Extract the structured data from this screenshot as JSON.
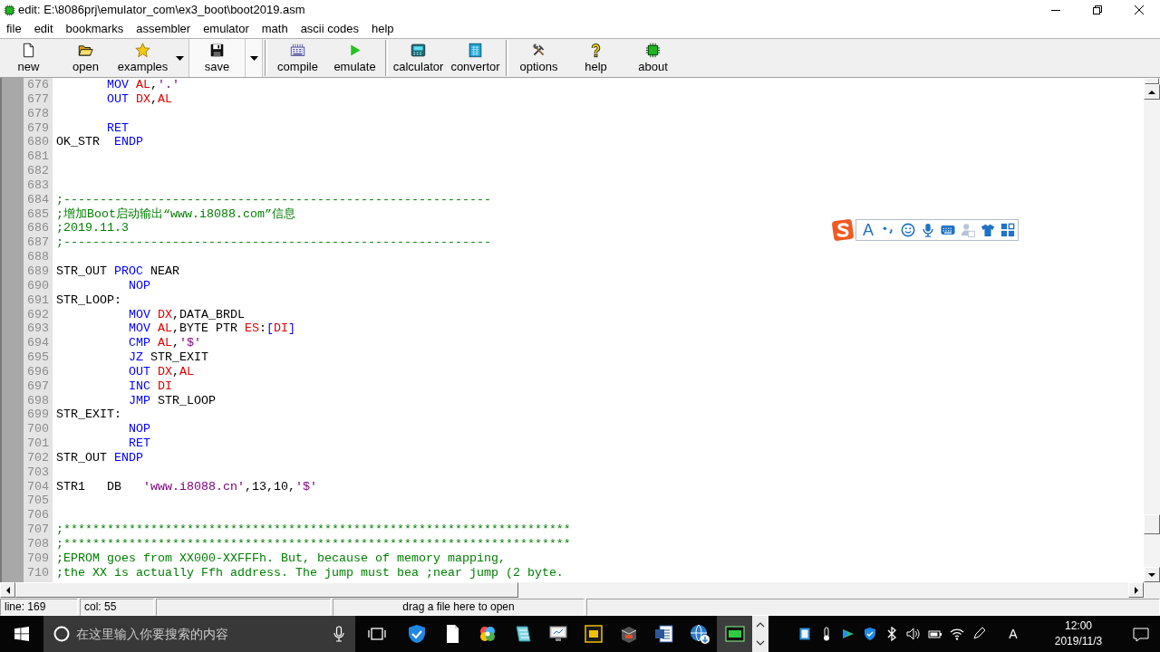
{
  "window": {
    "title": "edit: E:\\8086prj\\emulator_com\\ex3_boot\\boot2019.asm"
  },
  "menu": [
    "file",
    "edit",
    "bookmarks",
    "assembler",
    "emulator",
    "math",
    "ascii codes",
    "help"
  ],
  "toolbar": [
    {
      "buttons": [
        {
          "label": "new",
          "dropdown": false,
          "highlighted": false
        },
        {
          "label": "open",
          "dropdown": false,
          "highlighted": false
        },
        {
          "label": "examples",
          "dropdown": true,
          "highlighted": false
        },
        {
          "label": "save",
          "dropdown": true,
          "highlighted": true
        }
      ]
    },
    {
      "buttons": [
        {
          "label": "compile",
          "dropdown": false,
          "highlighted": false
        },
        {
          "label": "emulate",
          "dropdown": false,
          "highlighted": false
        }
      ]
    },
    {
      "buttons": [
        {
          "label": "calculator",
          "dropdown": false,
          "highlighted": false
        },
        {
          "label": "convertor",
          "dropdown": false,
          "highlighted": false
        }
      ]
    },
    {
      "buttons": [
        {
          "label": "options",
          "dropdown": false,
          "highlighted": false
        },
        {
          "label": "help",
          "dropdown": false,
          "highlighted": false
        },
        {
          "label": "about",
          "dropdown": false,
          "highlighted": false
        }
      ]
    }
  ],
  "editor": {
    "lines": [
      {
        "number": "676",
        "tokens": [
          {
            "kind": "keyword",
            "text": "       MOV"
          },
          {
            "kind": "register",
            "text": " AL"
          },
          {
            "kind": "plain",
            "text": ","
          },
          {
            "kind": "string",
            "text": "'.'"
          }
        ]
      },
      {
        "number": "677",
        "tokens": [
          {
            "kind": "keyword",
            "text": "       OUT"
          },
          {
            "kind": "register",
            "text": " DX"
          },
          {
            "kind": "plain",
            "text": ","
          },
          {
            "kind": "register",
            "text": "AL"
          }
        ]
      },
      {
        "number": "678"
      },
      {
        "number": "679",
        "tokens": [
          {
            "kind": "keyword",
            "text": "       RET"
          }
        ]
      },
      {
        "number": "680",
        "tokens": [
          {
            "kind": "plain",
            "text": "OK_STR"
          },
          {
            "kind": "keyword",
            "text": "  ENDP"
          }
        ]
      },
      {
        "number": "681"
      },
      {
        "number": "682"
      },
      {
        "number": "683"
      },
      {
        "number": "684",
        "tokens": [
          {
            "kind": "comment",
            "text": ";-----------------------------------------------------------"
          }
        ]
      },
      {
        "number": "685",
        "tokens": [
          {
            "kind": "comment",
            "text": ";增加Boot启动输出“www.i8088.com”信息"
          }
        ]
      },
      {
        "number": "686",
        "tokens": [
          {
            "kind": "comment",
            "text": ";2019.11.3"
          }
        ]
      },
      {
        "number": "687",
        "tokens": [
          {
            "kind": "comment",
            "text": ";-----------------------------------------------------------"
          }
        ]
      },
      {
        "number": "688"
      },
      {
        "number": "689",
        "tokens": [
          {
            "kind": "plain",
            "text": "STR_OUT"
          },
          {
            "kind": "keyword",
            "text": " PROC"
          },
          {
            "kind": "plain",
            "text": " NEAR"
          }
        ]
      },
      {
        "number": "690",
        "tokens": [
          {
            "kind": "keyword",
            "text": "          NOP"
          }
        ]
      },
      {
        "number": "691",
        "tokens": [
          {
            "kind": "plain",
            "text": "STR_LOOP:"
          }
        ]
      },
      {
        "number": "692",
        "tokens": [
          {
            "kind": "keyword",
            "text": "          MOV"
          },
          {
            "kind": "register",
            "text": " DX"
          },
          {
            "kind": "plain",
            "text": ",DATA_BRDL"
          }
        ]
      },
      {
        "number": "693",
        "tokens": [
          {
            "kind": "keyword",
            "text": "          MOV"
          },
          {
            "kind": "register",
            "text": " AL"
          },
          {
            "kind": "plain",
            "text": ",BYTE PTR "
          },
          {
            "kind": "register",
            "text": "ES"
          },
          {
            "kind": "plain",
            "text": ":"
          },
          {
            "kind": "keyword",
            "text": "["
          },
          {
            "kind": "register",
            "text": "DI"
          },
          {
            "kind": "keyword",
            "text": "]"
          }
        ]
      },
      {
        "number": "694",
        "tokens": [
          {
            "kind": "keyword",
            "text": "          CMP"
          },
          {
            "kind": "register",
            "text": " AL"
          },
          {
            "kind": "plain",
            "text": ","
          },
          {
            "kind": "string",
            "text": "'$'"
          }
        ]
      },
      {
        "number": "695",
        "tokens": [
          {
            "kind": "keyword",
            "text": "          JZ"
          },
          {
            "kind": "plain",
            "text": " STR_EXIT"
          }
        ]
      },
      {
        "number": "696",
        "tokens": [
          {
            "kind": "keyword",
            "text": "          OUT"
          },
          {
            "kind": "register",
            "text": " DX"
          },
          {
            "kind": "plain",
            "text": ","
          },
          {
            "kind": "register",
            "text": "AL"
          }
        ]
      },
      {
        "number": "697",
        "tokens": [
          {
            "kind": "keyword",
            "text": "          INC"
          },
          {
            "kind": "register",
            "text": " DI"
          }
        ]
      },
      {
        "number": "698",
        "tokens": [
          {
            "kind": "keyword",
            "text": "          JMP"
          },
          {
            "kind": "plain",
            "text": " STR_LOOP"
          }
        ]
      },
      {
        "number": "699",
        "tokens": [
          {
            "kind": "plain",
            "text": "STR_EXIT:"
          }
        ]
      },
      {
        "number": "700",
        "tokens": [
          {
            "kind": "keyword",
            "text": "          NOP"
          }
        ]
      },
      {
        "number": "701",
        "tokens": [
          {
            "kind": "keyword",
            "text": "          RET"
          }
        ]
      },
      {
        "number": "702",
        "tokens": [
          {
            "kind": "plain",
            "text": "STR_OUT"
          },
          {
            "kind": "keyword",
            "text": " ENDP"
          }
        ]
      },
      {
        "number": "703"
      },
      {
        "number": "704",
        "tokens": [
          {
            "kind": "plain",
            "text": "STR1   DB"
          },
          {
            "kind": "string",
            "text": "   'www.i8088.cn'"
          },
          {
            "kind": "plain",
            "text": ",13,10,"
          },
          {
            "kind": "string",
            "text": "'$'"
          }
        ]
      },
      {
        "number": "705"
      },
      {
        "number": "706"
      },
      {
        "number": "707",
        "tokens": [
          {
            "kind": "comment",
            "text": ";**********************************************************************"
          }
        ]
      },
      {
        "number": "708",
        "tokens": [
          {
            "kind": "comment",
            "text": ";**********************************************************************"
          }
        ]
      },
      {
        "number": "709",
        "tokens": [
          {
            "kind": "comment",
            "text": ";EPROM goes from XX000-XXFFFh. But, because of memory mapping,"
          }
        ]
      },
      {
        "number": "710",
        "tokens": [
          {
            "kind": "comment",
            "text": ";the XX is actually Ffh address. The jump must bea ;near jump (2 byte."
          }
        ]
      }
    ]
  },
  "ime_toolbar": {
    "mode": "A"
  },
  "status_bar": {
    "line": "line: 169",
    "column": "col: 55",
    "hint": "drag a file here to open"
  },
  "taskbar": {
    "search": {
      "placeholder": "在这里输入你要搜索的内容"
    },
    "apps": [
      {
        "selected": false
      },
      {
        "selected": false
      },
      {
        "selected": false
      },
      {
        "selected": false
      },
      {
        "selected": false
      },
      {
        "selected": false
      },
      {
        "selected": false
      },
      {
        "selected": false
      },
      {
        "selected": false
      },
      {
        "selected": true
      }
    ],
    "tray": {
      "input_mode": "A"
    },
    "clock": {
      "time": "12:00",
      "date": "2019/11/3"
    }
  }
}
